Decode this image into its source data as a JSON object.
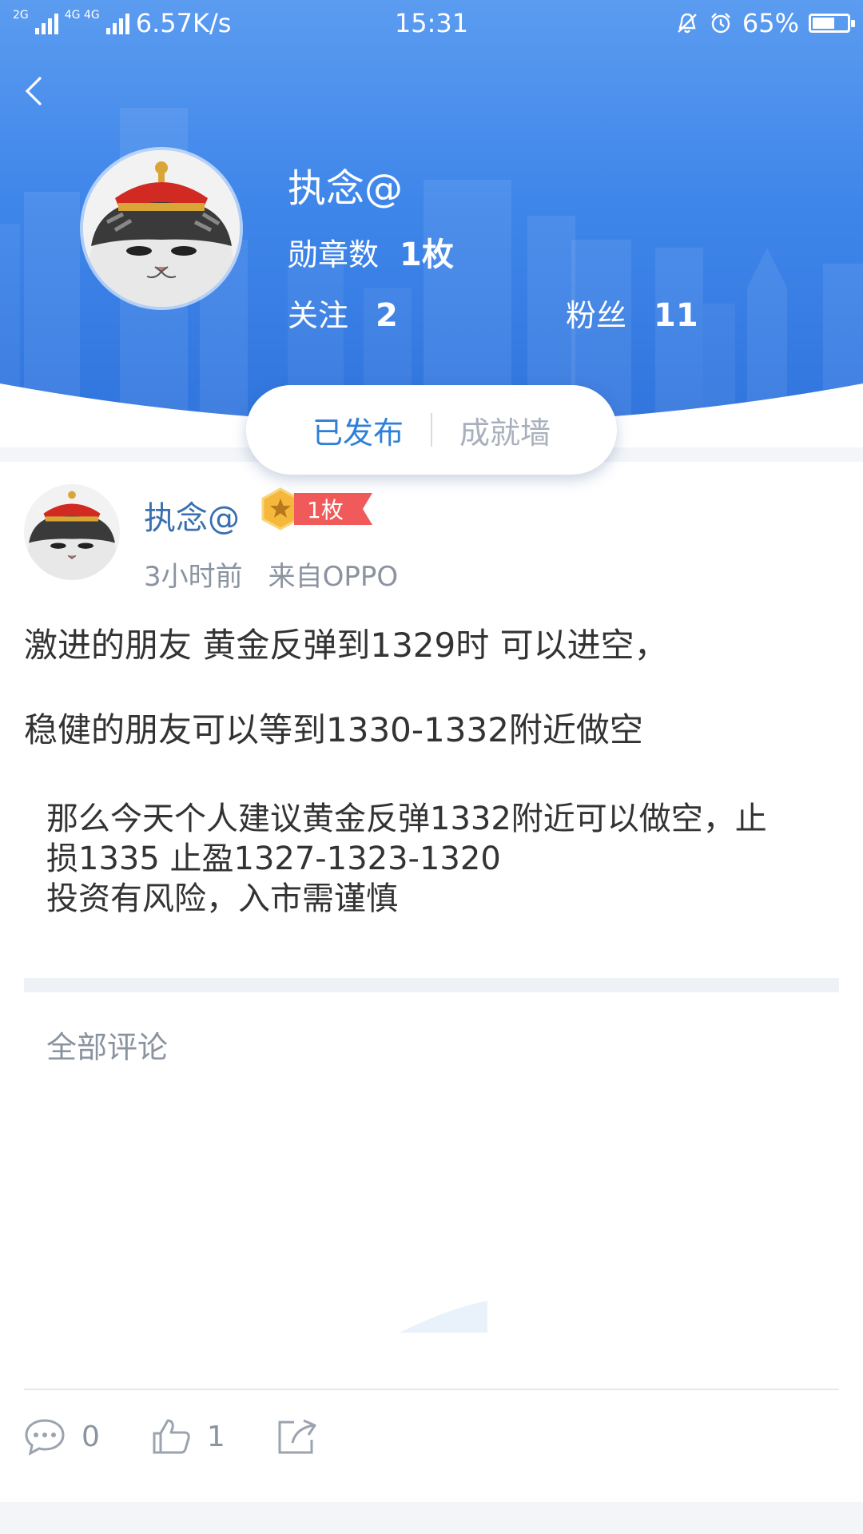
{
  "status_bar": {
    "net_left": "2G",
    "net_right": "4G 4G",
    "speed": "6.57K/s",
    "time": "15:31",
    "battery": "65%",
    "battery_level": 0.65,
    "icons": [
      "signal-icon",
      "bell-mute-icon",
      "alarm-icon",
      "battery-icon"
    ]
  },
  "profile": {
    "name": "执念@",
    "badge_label": "勋章数",
    "badge_count": "1枚",
    "follow_label": "关注",
    "follow_count": "2",
    "fans_label": "粉丝",
    "fans_count": "11"
  },
  "tabs": {
    "active": "已发布",
    "other": "成就墙"
  },
  "post": {
    "author": "执念@",
    "medal_count": "1枚",
    "time_ago": "3小时前",
    "source": "来自OPPO",
    "line1": "激进的朋友 黄金反弹到1329时 可以进空，",
    "line2": "稳健的朋友可以等到1330-1332附近做空",
    "quote": [
      "那么今天个人建议黄金反弹1332附近可以做空，止",
      "损1335  止盈1327-1323-1320",
      "投资有风险，入市需谨慎"
    ]
  },
  "comments": {
    "title": "全部评论"
  },
  "actions": {
    "comment_count": "0",
    "like_count": "1"
  },
  "colors": {
    "header_blue": "#3f86ea",
    "tab_active": "#2d7fd8",
    "username_blue": "#3a6fb0",
    "medal_red": "#f05a5a",
    "medal_gold": "#f5b83a"
  }
}
